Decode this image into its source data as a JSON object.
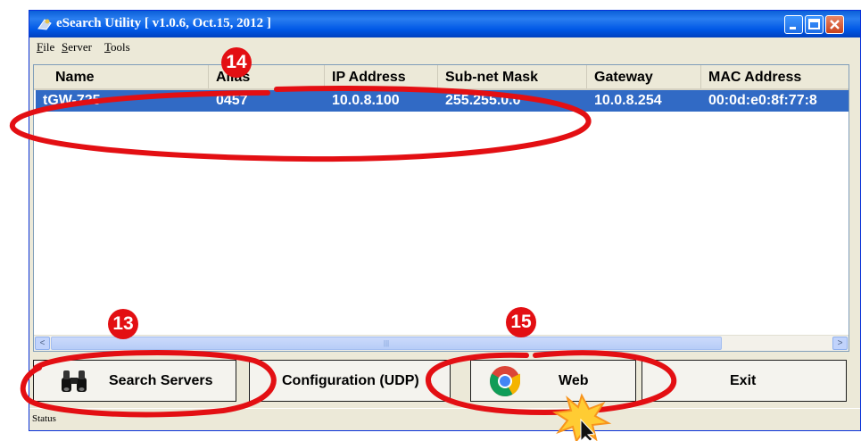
{
  "window": {
    "title": "eSearch Utility [ v1.0.6, Oct.15, 2012 ]",
    "icon": "app-icon",
    "controls": [
      "minimize-icon",
      "maximize-icon",
      "close-icon"
    ]
  },
  "menu": {
    "items": [
      {
        "first": "F",
        "rest": "ile"
      },
      {
        "first": "S",
        "rest": "erver"
      },
      {
        "first": "T",
        "rest": "ools"
      }
    ]
  },
  "table": {
    "columns": [
      "Name",
      "Alias",
      "IP Address",
      "Sub-net Mask",
      "Gateway",
      "MAC Address"
    ],
    "rows": [
      [
        "tGW-725",
        "0457",
        "10.0.8.100",
        "255.255.0.0",
        "10.0.8.254",
        "00:0d:e0:8f:77:8"
      ]
    ]
  },
  "scrollbar": {
    "left_arrow": "<",
    "right_arrow": ">",
    "grip": "|||"
  },
  "buttons": {
    "search": "Search Servers",
    "config": "Configuration (UDP)",
    "web": "Web",
    "exit": "Exit"
  },
  "status": {
    "text": "Status"
  },
  "annotations": {
    "step13": "13",
    "step14": "14",
    "step15": "15"
  },
  "colors": {
    "annotation_red": "#e30f13",
    "selection": "#316ac5",
    "title_bar": "#0058e6"
  }
}
